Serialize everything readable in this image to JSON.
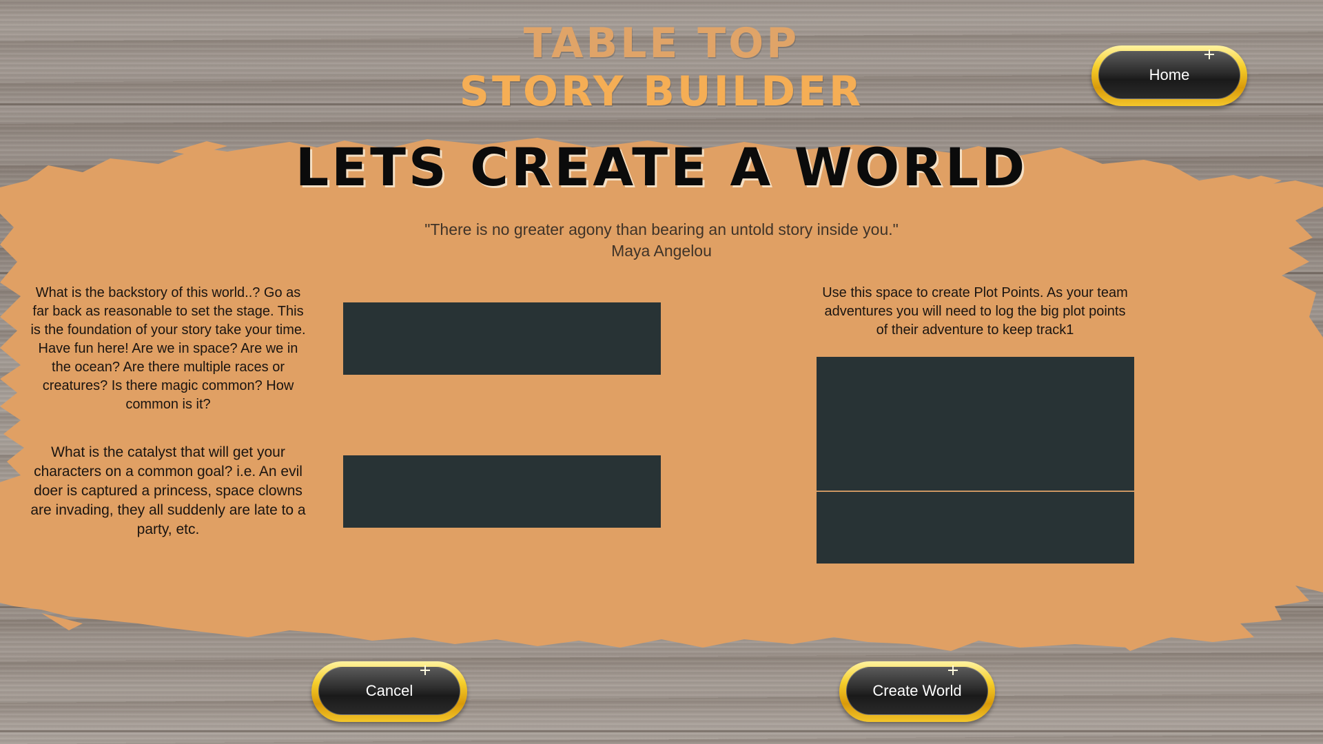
{
  "colors": {
    "splash_orange": "#e0a064",
    "field_dark": "#283335",
    "brand_gold": "#f5ae55",
    "button_gold": "#f6cf2c"
  },
  "brand": {
    "line1": "TABLE TOP",
    "line2": "STORY BUILDER"
  },
  "header": {
    "home_label": "Home"
  },
  "page": {
    "title": "LETS CREATE A WORLD",
    "quote": "\"There is no greater agony than bearing an untold story inside you.\"",
    "quote_author": "Maya Angelou"
  },
  "form": {
    "backstory_prompt": "What is the backstory of this world..? Go as far back as reasonable to set the stage. This is the foundation of your story take your time. Have fun here! Are we in space? Are we in the ocean? Are there multiple races or creatures? Is there magic common? How common is it?",
    "backstory_value": "",
    "catalyst_prompt": "What is the catalyst that will get your characters on a common goal? i.e. An evil doer is captured a princess, space clowns are invading, they all suddenly are late  to a party, etc.",
    "catalyst_value": "",
    "plot_prompt": "Use this space to create Plot Points. As your team adventures you will  need to log the big plot points of their adventure to keep track1",
    "plot_value_1": "",
    "plot_value_2": ""
  },
  "actions": {
    "cancel_label": "Cancel",
    "create_label": "Create World"
  }
}
